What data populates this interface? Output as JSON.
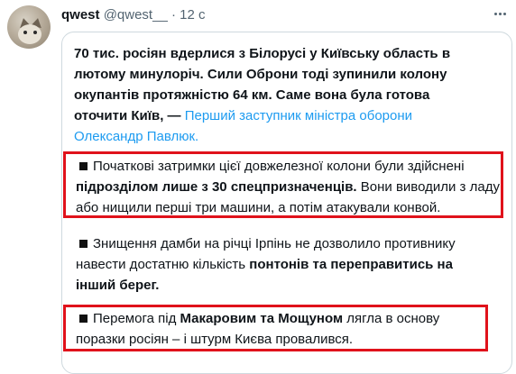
{
  "tweet": {
    "author_name": "qwest",
    "author_handle": "@qwest__",
    "separator": "·",
    "timestamp": "12 с"
  },
  "quote": {
    "intro_bold": "70 тис. росіян вдерлися з Білорусі у Київську область в лютому минулоріч. Сили Оброни тоді зупинили колону окупантів протяжністю 64 км. Саме вона була готова оточити Київ, —",
    "intro_link": "Перший заступник міністра оборони Олександр Павлюк.",
    "point1_a": "Початкові затримки цієї довжелезної колони були здійснені",
    "point1_bold": "підрозділом лише з 30 спецпризначенців.",
    "point1_b": "Вони виводили з ладу або нищили перші три машини, а потім атакували конвой.",
    "point2_a": "Знищення дамби на річці Ірпінь не дозволило противнику навести достатню кількість",
    "point2_bold": "понтонів та переправитись на інший берег.",
    "point3_a": "Перемога під",
    "point3_bold": "Макаровим та Мощуном",
    "point3_b": "лягла в основу поразки росіян – і штурм Києва провалився."
  },
  "colors": {
    "highlight_border": "#e0121b",
    "link": "#1d9bf0",
    "muted": "#536471"
  },
  "icons": {
    "more": "more-horizontal-icon",
    "bullet": "black-square-icon"
  }
}
